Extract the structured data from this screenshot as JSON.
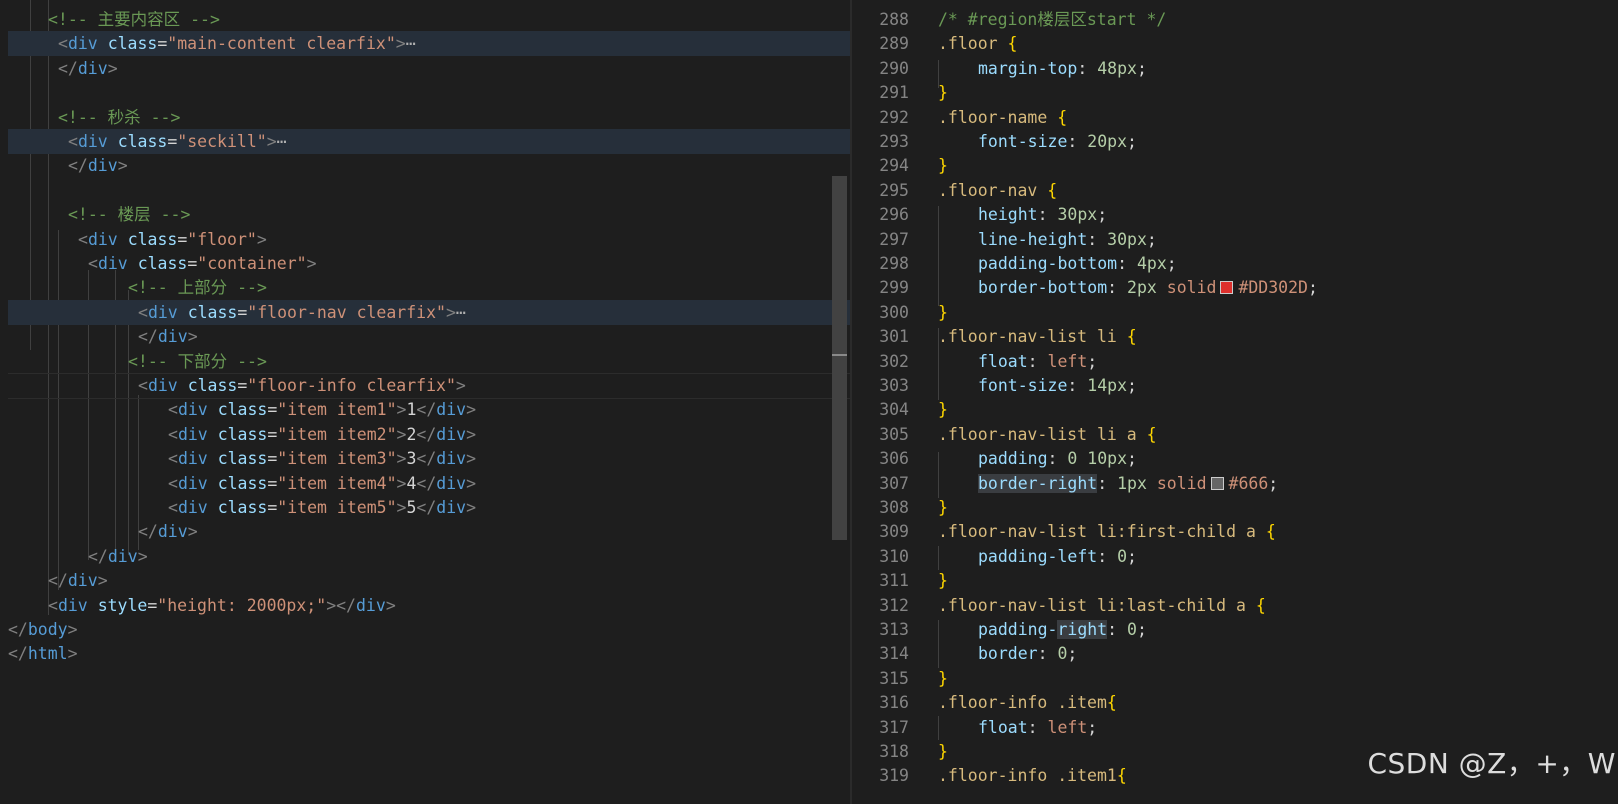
{
  "left_editor": {
    "lines": [
      [
        {
          "t": "<!-- 主要内容区 -->",
          "c": "comment"
        }
      ],
      [
        {
          "t": "<",
          "c": "bracket"
        },
        {
          "t": "div",
          "c": "tag"
        },
        {
          "t": " ",
          "c": "text"
        },
        {
          "t": "class",
          "c": "attr"
        },
        {
          "t": "=",
          "c": "text"
        },
        {
          "t": "\"main-content clearfix\"",
          "c": "str"
        },
        {
          "t": ">",
          "c": "bracket"
        },
        {
          "t": "⋯",
          "c": "ellipsis"
        }
      ],
      [
        {
          "t": "</",
          "c": "bracket"
        },
        {
          "t": "div",
          "c": "tag"
        },
        {
          "t": ">",
          "c": "bracket"
        }
      ],
      [],
      [
        {
          "t": "<!-- 秒杀 -->",
          "c": "comment"
        }
      ],
      [
        {
          "t": "<",
          "c": "bracket"
        },
        {
          "t": "div",
          "c": "tag"
        },
        {
          "t": " ",
          "c": "text"
        },
        {
          "t": "class",
          "c": "attr"
        },
        {
          "t": "=",
          "c": "text"
        },
        {
          "t": "\"seckill\"",
          "c": "str"
        },
        {
          "t": ">",
          "c": "bracket"
        },
        {
          "t": "⋯",
          "c": "ellipsis"
        }
      ],
      [
        {
          "t": "</",
          "c": "bracket"
        },
        {
          "t": "div",
          "c": "tag"
        },
        {
          "t": ">",
          "c": "bracket"
        }
      ],
      [],
      [
        {
          "t": "<!-- 楼层 -->",
          "c": "comment"
        }
      ],
      [
        {
          "t": "<",
          "c": "bracket"
        },
        {
          "t": "div",
          "c": "tag"
        },
        {
          "t": " ",
          "c": "text"
        },
        {
          "t": "class",
          "c": "attr"
        },
        {
          "t": "=",
          "c": "text"
        },
        {
          "t": "\"floor\"",
          "c": "str"
        },
        {
          "t": ">",
          "c": "bracket"
        }
      ],
      [
        {
          "t": "<",
          "c": "bracket"
        },
        {
          "t": "div",
          "c": "tag"
        },
        {
          "t": " ",
          "c": "text"
        },
        {
          "t": "class",
          "c": "attr"
        },
        {
          "t": "=",
          "c": "text"
        },
        {
          "t": "\"container\"",
          "c": "str"
        },
        {
          "t": ">",
          "c": "bracket"
        }
      ],
      [
        {
          "t": "<!-- 上部分 -->",
          "c": "comment"
        }
      ],
      [
        {
          "t": "<",
          "c": "bracket"
        },
        {
          "t": "div",
          "c": "tag"
        },
        {
          "t": " ",
          "c": "text"
        },
        {
          "t": "class",
          "c": "attr"
        },
        {
          "t": "=",
          "c": "text"
        },
        {
          "t": "\"floor-nav clearfix\"",
          "c": "str"
        },
        {
          "t": ">",
          "c": "bracket"
        },
        {
          "t": "⋯",
          "c": "ellipsis"
        }
      ],
      [
        {
          "t": "</",
          "c": "bracket"
        },
        {
          "t": "div",
          "c": "tag"
        },
        {
          "t": ">",
          "c": "bracket"
        }
      ],
      [
        {
          "t": "<!-- 下部分 -->",
          "c": "comment"
        }
      ],
      [
        {
          "t": "<",
          "c": "bracket"
        },
        {
          "t": "div",
          "c": "tag"
        },
        {
          "t": " ",
          "c": "text"
        },
        {
          "t": "class",
          "c": "attr"
        },
        {
          "t": "=",
          "c": "text"
        },
        {
          "t": "\"floor-info clearfix\"",
          "c": "str"
        },
        {
          "t": ">",
          "c": "bracket"
        }
      ],
      [
        {
          "t": "<",
          "c": "bracket"
        },
        {
          "t": "div",
          "c": "tag"
        },
        {
          "t": " ",
          "c": "text"
        },
        {
          "t": "class",
          "c": "attr"
        },
        {
          "t": "=",
          "c": "text"
        },
        {
          "t": "\"item item1\"",
          "c": "str"
        },
        {
          "t": ">",
          "c": "bracket"
        },
        {
          "t": "1",
          "c": "text"
        },
        {
          "t": "</",
          "c": "bracket"
        },
        {
          "t": "div",
          "c": "tag"
        },
        {
          "t": ">",
          "c": "bracket"
        }
      ],
      [
        {
          "t": "<",
          "c": "bracket"
        },
        {
          "t": "div",
          "c": "tag"
        },
        {
          "t": " ",
          "c": "text"
        },
        {
          "t": "class",
          "c": "attr"
        },
        {
          "t": "=",
          "c": "text"
        },
        {
          "t": "\"item item2\"",
          "c": "str"
        },
        {
          "t": ">",
          "c": "bracket"
        },
        {
          "t": "2",
          "c": "text"
        },
        {
          "t": "</",
          "c": "bracket"
        },
        {
          "t": "div",
          "c": "tag"
        },
        {
          "t": ">",
          "c": "bracket"
        }
      ],
      [
        {
          "t": "<",
          "c": "bracket"
        },
        {
          "t": "div",
          "c": "tag"
        },
        {
          "t": " ",
          "c": "text"
        },
        {
          "t": "class",
          "c": "attr"
        },
        {
          "t": "=",
          "c": "text"
        },
        {
          "t": "\"item item3\"",
          "c": "str"
        },
        {
          "t": ">",
          "c": "bracket"
        },
        {
          "t": "3",
          "c": "text"
        },
        {
          "t": "</",
          "c": "bracket"
        },
        {
          "t": "div",
          "c": "tag"
        },
        {
          "t": ">",
          "c": "bracket"
        }
      ],
      [
        {
          "t": "<",
          "c": "bracket"
        },
        {
          "t": "div",
          "c": "tag"
        },
        {
          "t": " ",
          "c": "text"
        },
        {
          "t": "class",
          "c": "attr"
        },
        {
          "t": "=",
          "c": "text"
        },
        {
          "t": "\"item item4\"",
          "c": "str"
        },
        {
          "t": ">",
          "c": "bracket"
        },
        {
          "t": "4",
          "c": "text"
        },
        {
          "t": "</",
          "c": "bracket"
        },
        {
          "t": "div",
          "c": "tag"
        },
        {
          "t": ">",
          "c": "bracket"
        }
      ],
      [
        {
          "t": "<",
          "c": "bracket"
        },
        {
          "t": "div",
          "c": "tag"
        },
        {
          "t": " ",
          "c": "text"
        },
        {
          "t": "class",
          "c": "attr"
        },
        {
          "t": "=",
          "c": "text"
        },
        {
          "t": "\"item item5\"",
          "c": "str"
        },
        {
          "t": ">",
          "c": "bracket"
        },
        {
          "t": "5",
          "c": "text"
        },
        {
          "t": "</",
          "c": "bracket"
        },
        {
          "t": "div",
          "c": "tag"
        },
        {
          "t": ">",
          "c": "bracket"
        }
      ],
      [
        {
          "t": "</",
          "c": "bracket"
        },
        {
          "t": "div",
          "c": "tag"
        },
        {
          "t": ">",
          "c": "bracket"
        }
      ],
      [
        {
          "t": "</",
          "c": "bracket"
        },
        {
          "t": "div",
          "c": "tag"
        },
        {
          "t": ">",
          "c": "bracket"
        }
      ],
      [
        {
          "t": "</",
          "c": "bracket"
        },
        {
          "t": "div",
          "c": "tag"
        },
        {
          "t": ">",
          "c": "bracket"
        }
      ],
      [
        {
          "t": "<",
          "c": "bracket"
        },
        {
          "t": "div",
          "c": "tag"
        },
        {
          "t": " ",
          "c": "text"
        },
        {
          "t": "style",
          "c": "attr"
        },
        {
          "t": "=",
          "c": "text"
        },
        {
          "t": "\"height: 2000px;\"",
          "c": "str"
        },
        {
          "t": "></",
          "c": "bracket"
        },
        {
          "t": "div",
          "c": "tag"
        },
        {
          "t": ">",
          "c": "bracket"
        }
      ],
      [
        {
          "t": "</",
          "c": "bracket"
        },
        {
          "t": "body",
          "c": "tag"
        },
        {
          "t": ">",
          "c": "bracket"
        }
      ],
      [
        {
          "t": "</",
          "c": "bracket"
        },
        {
          "t": "html",
          "c": "tag"
        },
        {
          "t": ">",
          "c": "bracket"
        }
      ]
    ]
  },
  "right_editor": {
    "line_numbers": [
      "288",
      "289",
      "290",
      "291",
      "292",
      "293",
      "294",
      "295",
      "296",
      "297",
      "298",
      "299",
      "300",
      "301",
      "302",
      "303",
      "304",
      "305",
      "306",
      "307",
      "308",
      "309",
      "310",
      "311",
      "312",
      "313",
      "314",
      "315",
      "316",
      "317",
      "318",
      "319"
    ],
    "lines": [
      [
        {
          "t": "/* #region楼层区start */",
          "c": "comment"
        }
      ],
      [
        {
          "t": ".floor",
          "c": "sel"
        },
        {
          "t": " {",
          "c": "brace"
        }
      ],
      [
        {
          "t": "margin-top",
          "c": "prop"
        },
        {
          "t": ": ",
          "c": "text"
        },
        {
          "t": "48px",
          "c": "num"
        },
        {
          "t": ";",
          "c": "text"
        }
      ],
      [
        {
          "t": "}",
          "c": "brace"
        }
      ],
      [
        {
          "t": ".floor-name",
          "c": "sel"
        },
        {
          "t": " {",
          "c": "brace"
        }
      ],
      [
        {
          "t": "font-size",
          "c": "prop"
        },
        {
          "t": ": ",
          "c": "text"
        },
        {
          "t": "20px",
          "c": "num"
        },
        {
          "t": ";",
          "c": "text"
        }
      ],
      [
        {
          "t": "}",
          "c": "brace"
        }
      ],
      [
        {
          "t": ".floor-nav",
          "c": "sel"
        },
        {
          "t": " {",
          "c": "brace"
        }
      ],
      [
        {
          "t": "height",
          "c": "prop"
        },
        {
          "t": ": ",
          "c": "text"
        },
        {
          "t": "30px",
          "c": "num"
        },
        {
          "t": ";",
          "c": "text"
        }
      ],
      [
        {
          "t": "line-height",
          "c": "prop"
        },
        {
          "t": ": ",
          "c": "text"
        },
        {
          "t": "30px",
          "c": "num"
        },
        {
          "t": ";",
          "c": "text"
        }
      ],
      [
        {
          "t": "padding-bottom",
          "c": "prop"
        },
        {
          "t": ": ",
          "c": "text"
        },
        {
          "t": "4px",
          "c": "num"
        },
        {
          "t": ";",
          "c": "text"
        }
      ],
      [
        {
          "t": "border-bottom",
          "c": "prop"
        },
        {
          "t": ": ",
          "c": "text"
        },
        {
          "t": "2px",
          "c": "num"
        },
        {
          "t": " solid",
          "c": "kw"
        },
        {
          "swatch": "#DD302D"
        },
        {
          "t": "#DD302D",
          "c": "kw"
        },
        {
          "t": ";",
          "c": "text"
        }
      ],
      [
        {
          "t": "}",
          "c": "brace"
        }
      ],
      [
        {
          "t": ".floor-nav-list li",
          "c": "sel"
        },
        {
          "t": " {",
          "c": "brace"
        }
      ],
      [
        {
          "t": "float",
          "c": "prop"
        },
        {
          "t": ": ",
          "c": "text"
        },
        {
          "t": "left",
          "c": "kw"
        },
        {
          "t": ";",
          "c": "text"
        }
      ],
      [
        {
          "t": "font-size",
          "c": "prop"
        },
        {
          "t": ": ",
          "c": "text"
        },
        {
          "t": "14px",
          "c": "num"
        },
        {
          "t": ";",
          "c": "text"
        }
      ],
      [
        {
          "t": "}",
          "c": "brace"
        }
      ],
      [
        {
          "t": ".floor-nav-list li a",
          "c": "sel"
        },
        {
          "t": " {",
          "c": "brace"
        }
      ],
      [
        {
          "t": "padding",
          "c": "prop"
        },
        {
          "t": ": ",
          "c": "text"
        },
        {
          "t": "0 10px",
          "c": "num"
        },
        {
          "t": ";",
          "c": "text"
        }
      ],
      [
        {
          "t": "border-right",
          "c": "prop",
          "hl": true
        },
        {
          "t": ": ",
          "c": "text"
        },
        {
          "t": "1px",
          "c": "num"
        },
        {
          "t": " solid",
          "c": "kw"
        },
        {
          "swatch": "#666666"
        },
        {
          "t": "#666",
          "c": "kw"
        },
        {
          "t": ";",
          "c": "text"
        }
      ],
      [
        {
          "t": "}",
          "c": "brace"
        }
      ],
      [
        {
          "t": ".floor-nav-list li:first-child a",
          "c": "sel"
        },
        {
          "t": " {",
          "c": "brace"
        }
      ],
      [
        {
          "t": "padding-left",
          "c": "prop"
        },
        {
          "t": ": ",
          "c": "text"
        },
        {
          "t": "0",
          "c": "num"
        },
        {
          "t": ";",
          "c": "text"
        }
      ],
      [
        {
          "t": "}",
          "c": "brace"
        }
      ],
      [
        {
          "t": ".floor-nav-list li:last-child a",
          "c": "sel"
        },
        {
          "t": " {",
          "c": "brace"
        }
      ],
      [
        {
          "t": "padding-",
          "c": "prop"
        },
        {
          "t": "right",
          "c": "prop",
          "hl": true
        },
        {
          "t": ": ",
          "c": "text"
        },
        {
          "t": "0",
          "c": "num"
        },
        {
          "t": ";",
          "c": "text"
        }
      ],
      [
        {
          "t": "border",
          "c": "prop"
        },
        {
          "t": ": ",
          "c": "text"
        },
        {
          "t": "0",
          "c": "num"
        },
        {
          "t": ";",
          "c": "text"
        }
      ],
      [
        {
          "t": "}",
          "c": "brace"
        }
      ],
      [
        {
          "t": ".floor-info .item",
          "c": "sel"
        },
        {
          "t": "{",
          "c": "brace"
        }
      ],
      [
        {
          "t": "float",
          "c": "prop"
        },
        {
          "t": ": ",
          "c": "text"
        },
        {
          "t": "left",
          "c": "kw"
        },
        {
          "t": ";",
          "c": "text"
        }
      ],
      [
        {
          "t": "}",
          "c": "brace"
        }
      ],
      [
        {
          "t": ".floor-info .item1",
          "c": "sel"
        },
        {
          "t": "{",
          "c": "brace"
        }
      ]
    ]
  },
  "watermark": "CSDN @Z，+，W"
}
